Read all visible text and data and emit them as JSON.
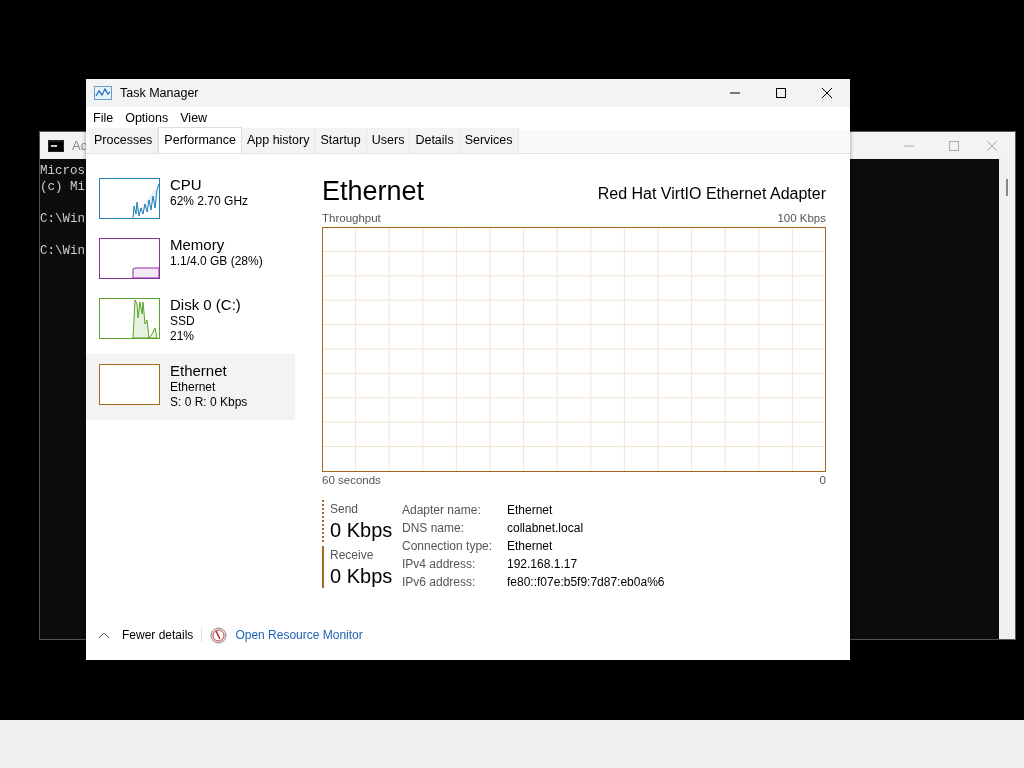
{
  "cmd_window": {
    "title": "Ad",
    "paragraphs": [
      [
        "Micros",
        "(c) Mi"
      ],
      [
        "C:\\Win"
      ],
      [
        "C:\\Win"
      ]
    ]
  },
  "task_manager": {
    "title": "Task Manager",
    "menu": [
      "File",
      "Options",
      "View"
    ],
    "tabs": [
      {
        "label": "Processes",
        "selected": false
      },
      {
        "label": "Performance",
        "selected": true
      },
      {
        "label": "App history",
        "selected": false
      },
      {
        "label": "Startup",
        "selected": false
      },
      {
        "label": "Users",
        "selected": false
      },
      {
        "label": "Details",
        "selected": false
      },
      {
        "label": "Services",
        "selected": false
      }
    ],
    "sidebar": {
      "items": [
        {
          "kind": "cpu",
          "name": "CPU",
          "details": [
            "62%  2.70 GHz"
          ],
          "color": "#1f7fb6",
          "selected": false
        },
        {
          "kind": "memory",
          "name": "Memory",
          "details": [
            "1.1/4.0 GB (28%)"
          ],
          "color": "#8b2d9e",
          "selected": false
        },
        {
          "kind": "disk",
          "name": "Disk 0 (C:)",
          "details": [
            "SSD",
            "21%"
          ],
          "color": "#5ca12a",
          "selected": false
        },
        {
          "kind": "ethernet",
          "name": "Ethernet",
          "details": [
            "Ethernet",
            "S: 0 R: 0 Kbps"
          ],
          "color": "#a7671c",
          "selected": true
        }
      ]
    },
    "detail": {
      "title": "Ethernet",
      "subtitle": "Red Hat VirtIO Ethernet Adapter",
      "graph": {
        "label": "Throughput",
        "max": "100 Kbps",
        "span": "60 seconds",
        "min": "0"
      },
      "stats": [
        {
          "kind": "send",
          "label": "Send",
          "value": "0 Kbps"
        },
        {
          "kind": "receive",
          "label": "Receive",
          "value": "0 Kbps"
        }
      ],
      "properties": [
        {
          "label": "Adapter name:",
          "value": "Ethernet"
        },
        {
          "label": "DNS name:",
          "value": "collabnet.local"
        },
        {
          "label": "Connection type:",
          "value": "Ethernet"
        },
        {
          "label": "IPv4 address:",
          "value": "192.168.1.17"
        },
        {
          "label": "IPv6 address:",
          "value": "fe80::f07e:b5f9:7d87:eb0a%6"
        }
      ]
    },
    "footer": {
      "fewer_details": "Fewer details",
      "resource_monitor": "Open Resource Monitor"
    }
  }
}
